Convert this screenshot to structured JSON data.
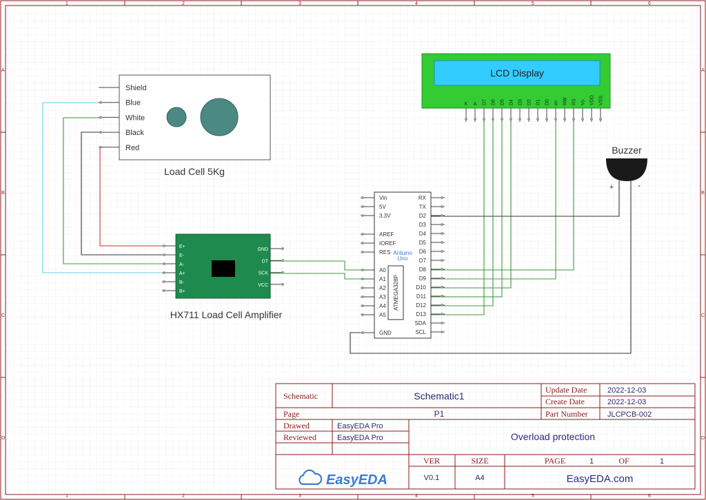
{
  "frame": {
    "col_labels": [
      "1",
      "2",
      "3",
      "4",
      "5",
      "6"
    ],
    "row_labels": [
      "A",
      "B",
      "C",
      "D"
    ]
  },
  "load_cell": {
    "title": "Load Cell 5Kg",
    "wires": [
      "Shield",
      "Blue",
      "White",
      "Black",
      "Red"
    ]
  },
  "hx711": {
    "title": "HX711 Load Cell Amplifier",
    "left_pins": [
      "E+",
      "E-",
      "A-",
      "A+",
      "B-",
      "B+"
    ],
    "right_pins": [
      "GND",
      "DT",
      "SCK",
      "VCC"
    ]
  },
  "arduino": {
    "label": "Arduino Uno",
    "chip": "ATMEGA328P",
    "left_pins": [
      "Vin",
      "5V",
      "3.3V",
      "AREF",
      "IOREF",
      "RES",
      "A0",
      "A1",
      "A2",
      "A3",
      "A4",
      "A5",
      "GND"
    ],
    "right_pins": [
      "RX",
      "TX",
      "D2",
      "D3",
      "D4",
      "D5",
      "D6",
      "D7",
      "D8",
      "D9",
      "D10",
      "D11",
      "D12",
      "D13",
      "SDA",
      "SCL"
    ]
  },
  "lcd": {
    "title": "LCD Display",
    "pins": [
      "K",
      "A",
      "D7",
      "D6",
      "D5",
      "D4",
      "D3",
      "D2",
      "D1",
      "D0",
      "en",
      "RW",
      "RS",
      "Vo",
      "VDD",
      "VSS"
    ]
  },
  "buzzer": {
    "title": "Buzzer",
    "plus": "+",
    "minus": "-"
  },
  "title_block": {
    "schematic_label": "Schematic",
    "schematic_value": "Schematic1",
    "page_label": "Page",
    "page_value": "P1",
    "drawed_label": "Drawed",
    "drawed_value": "EasyEDA Pro",
    "reviewed_label": "Reviewed",
    "reviewed_value": "EasyEDA Pro",
    "update_date_label": "Update Date",
    "update_date_value": "2022-12-03",
    "create_date_label": "Create Date",
    "create_date_value": "2022-12-03",
    "part_number_label": "Part Number",
    "part_number_value": "JLCPCB-002",
    "project": "Overload protection",
    "ver_label": "VER",
    "ver_value": "V0.1",
    "size_label": "SIZE",
    "size_value": "A4",
    "page_num_label": "PAGE",
    "page_num_value": "1",
    "of_label": "OF",
    "of_value": "1",
    "logo_text": "EasyEDA",
    "website": "EasyEDA.com"
  },
  "colors": {
    "border": "#8b1a1a",
    "wire": "#333333",
    "wire_green": "#3c9a3c",
    "wire_red": "#d62a2a",
    "wire_cyan": "#5fd3e8",
    "hx711_board": "#1e8a4e",
    "lcd_board": "#33cc33",
    "lcd_screen": "#33ccff",
    "logo": "#3a7bd5"
  }
}
